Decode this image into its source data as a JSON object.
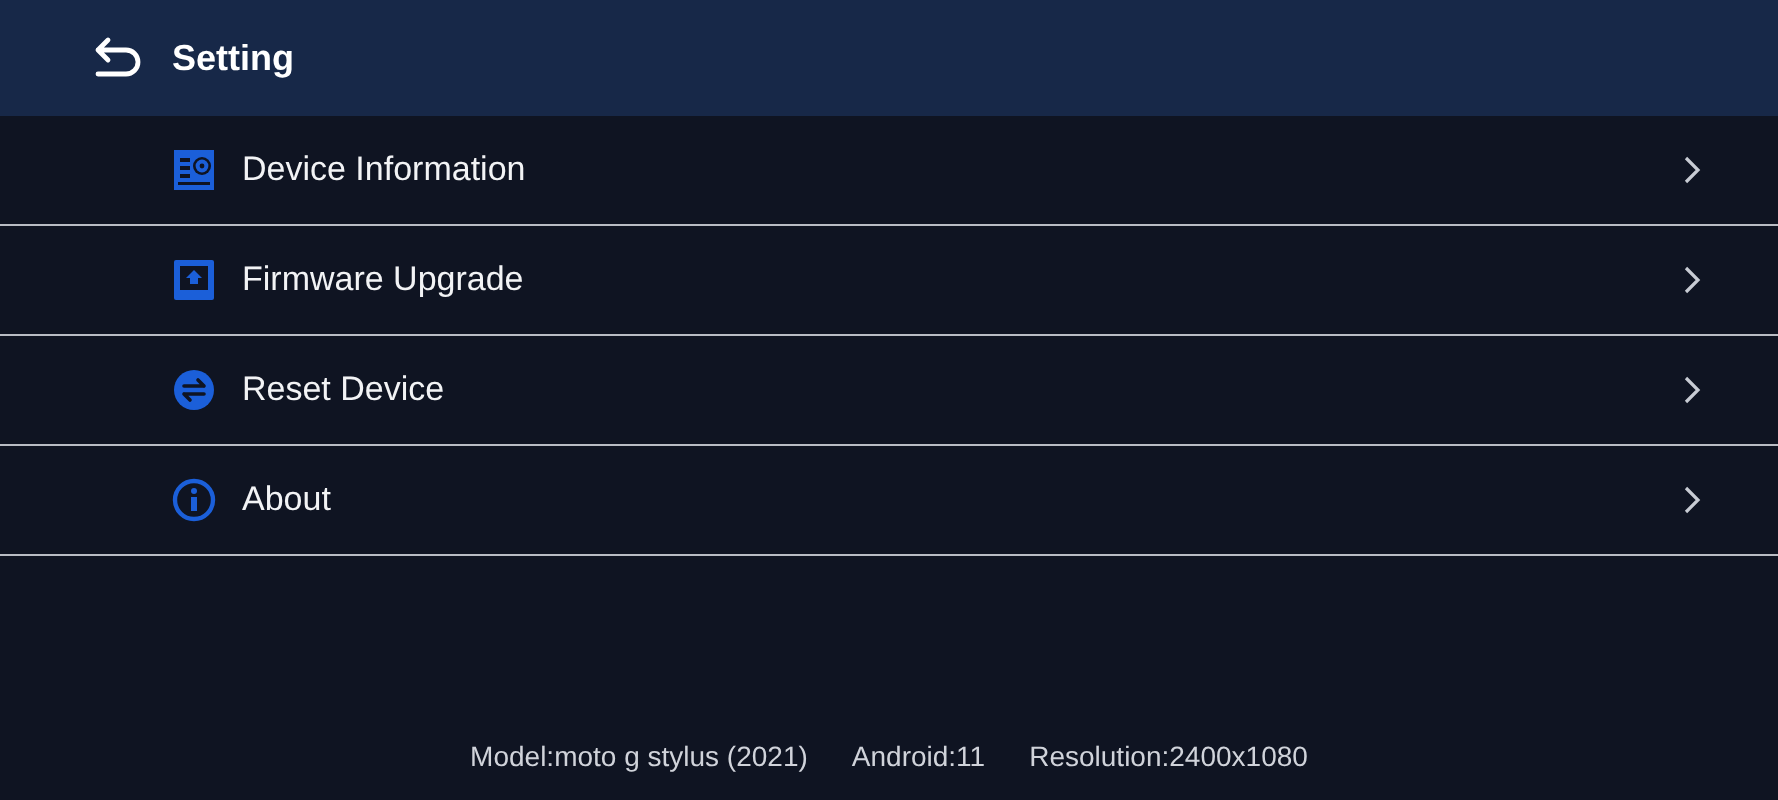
{
  "header": {
    "title": "Setting"
  },
  "items": [
    {
      "kind": "info",
      "label": "Device Information"
    },
    {
      "kind": "upgrade",
      "label": "Firmware Upgrade"
    },
    {
      "kind": "reset",
      "label": "Reset Device"
    },
    {
      "kind": "about",
      "label": "About"
    }
  ],
  "footer": [
    "Model:moto g stylus (2021)",
    "Android:11",
    "Resolution:2400x1080"
  ]
}
